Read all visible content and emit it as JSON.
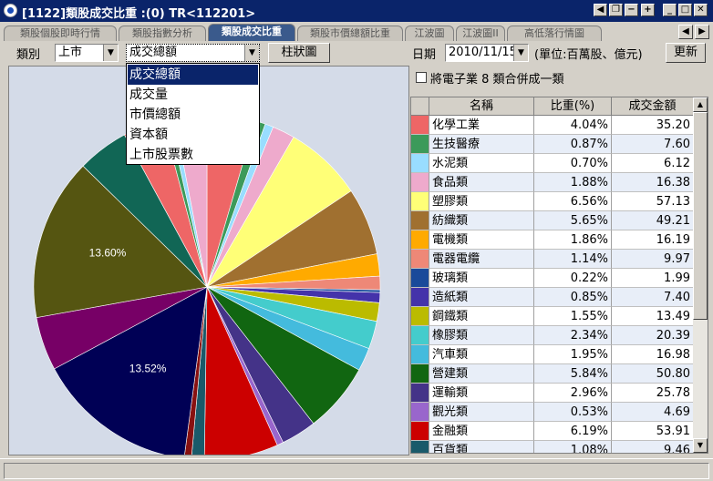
{
  "window": {
    "title": "[1122]類股成交比重 :(0) TR<112201>",
    "controls": [
      "◀",
      "❐",
      "−",
      "+",
      "_",
      "□",
      "✕"
    ]
  },
  "tabs": [
    {
      "label": "類股個股即時行情",
      "active": false
    },
    {
      "label": "類股指數分析",
      "active": false
    },
    {
      "label": "類股成交比重",
      "active": true
    },
    {
      "label": "類股市價總額比重",
      "active": false
    },
    {
      "label": "江波圖",
      "active": false
    },
    {
      "label": "江波圖II",
      "active": false
    },
    {
      "label": "高低落行情圖",
      "active": false
    }
  ],
  "toolbar": {
    "category_label": "類別",
    "market_value": "上市",
    "metric_value": "成交總額",
    "chart_button": "柱狀圖",
    "date_label": "日期",
    "date_value": "2010/11/15",
    "unit_label": "(單位:百萬股、億元)",
    "refresh_button": "更新"
  },
  "dropdown": {
    "options": [
      "成交總額",
      "成交量",
      "市價總額",
      "資本額",
      "上市股票數"
    ],
    "selected": "成交總額"
  },
  "merge_checkbox": {
    "label": "將電子業 8 類合併成一類",
    "checked": false
  },
  "table": {
    "headers": [
      "名稱",
      "比重(%)",
      "成交金額"
    ],
    "rows": [
      {
        "name": "化學工業",
        "pct": "4.04%",
        "amount": "35.20",
        "color": "#ee6666"
      },
      {
        "name": "生技醫療",
        "pct": "0.87%",
        "amount": "7.60",
        "color": "#3c9a5a"
      },
      {
        "name": "水泥類",
        "pct": "0.70%",
        "amount": "6.12",
        "color": "#99ddff"
      },
      {
        "name": "食品類",
        "pct": "1.88%",
        "amount": "16.38",
        "color": "#eeaacc"
      },
      {
        "name": "塑膠類",
        "pct": "6.56%",
        "amount": "57.13",
        "color": "#ffff77"
      },
      {
        "name": "紡織類",
        "pct": "5.65%",
        "amount": "49.21",
        "color": "#a07030"
      },
      {
        "name": "電機類",
        "pct": "1.86%",
        "amount": "16.19",
        "color": "#ffaa00"
      },
      {
        "name": "電器電纜",
        "pct": "1.14%",
        "amount": "9.97",
        "color": "#ee8877"
      },
      {
        "name": "玻璃類",
        "pct": "0.22%",
        "amount": "1.99",
        "color": "#1a4a9a"
      },
      {
        "name": "造紙類",
        "pct": "0.85%",
        "amount": "7.40",
        "color": "#4433aa"
      },
      {
        "name": "鋼鐵類",
        "pct": "1.55%",
        "amount": "13.49",
        "color": "#bbbb00"
      },
      {
        "name": "橡膠類",
        "pct": "2.34%",
        "amount": "20.39",
        "color": "#44cccc"
      },
      {
        "name": "汽車類",
        "pct": "1.95%",
        "amount": "16.98",
        "color": "#44bbdd"
      },
      {
        "name": "營建類",
        "pct": "5.84%",
        "amount": "50.80",
        "color": "#116611"
      },
      {
        "name": "運輸類",
        "pct": "2.96%",
        "amount": "25.78",
        "color": "#443388"
      },
      {
        "name": "觀光類",
        "pct": "0.53%",
        "amount": "4.69",
        "color": "#9966cc"
      },
      {
        "name": "金融類",
        "pct": "6.19%",
        "amount": "53.91",
        "color": "#cc0000"
      },
      {
        "name": "百貨類",
        "pct": "1.08%",
        "amount": "9.46",
        "color": "#1a5a6a"
      }
    ]
  },
  "chart_data": {
    "type": "pie",
    "series": [
      {
        "name": "化學工業",
        "value": 4.04,
        "color": "#ee6666"
      },
      {
        "name": "生技醫療",
        "value": 0.87,
        "color": "#3c9a5a"
      },
      {
        "name": "水泥類",
        "value": 0.7,
        "color": "#99ddff"
      },
      {
        "name": "食品類",
        "value": 1.88,
        "color": "#eeaacc"
      },
      {
        "name": "塑膠類",
        "value": 6.56,
        "color": "#ffff77"
      },
      {
        "name": "紡織類",
        "value": 5.65,
        "color": "#a07030"
      },
      {
        "name": "電機類",
        "value": 1.86,
        "color": "#ffaa00"
      },
      {
        "name": "電器電纜",
        "value": 1.14,
        "color": "#ee8877"
      },
      {
        "name": "玻璃類",
        "value": 0.22,
        "color": "#1a4a9a"
      },
      {
        "name": "造紙類",
        "value": 0.85,
        "color": "#4433aa"
      },
      {
        "name": "鋼鐵類",
        "value": 1.55,
        "color": "#bbbb00"
      },
      {
        "name": "橡膠類",
        "value": 2.34,
        "color": "#44cccc"
      },
      {
        "name": "汽車類",
        "value": 1.95,
        "color": "#44bbdd"
      },
      {
        "name": "營建類",
        "value": 5.84,
        "color": "#116611"
      },
      {
        "name": "運輸類",
        "value": 2.96,
        "color": "#443388"
      },
      {
        "name": "觀光類",
        "value": 0.53,
        "color": "#9966cc"
      },
      {
        "name": "金融類",
        "value": 6.19,
        "color": "#cc0000"
      },
      {
        "name": "百貨類",
        "value": 1.08,
        "color": "#1a5a6a"
      },
      {
        "name": "",
        "value": 0.6,
        "color": "#881111"
      },
      {
        "name": "",
        "value": 13.52,
        "color": "#000055"
      },
      {
        "name": "",
        "value": 4.5,
        "color": "#770066"
      },
      {
        "name": "",
        "value": 13.6,
        "color": "#555511"
      },
      {
        "name": "",
        "value": 4.3,
        "color": "#116655"
      },
      {
        "name": "",
        "value": 3.4,
        "color": "#ee6666"
      },
      {
        "name": "",
        "value": 0.5,
        "color": "#3c9a5a"
      },
      {
        "name": "",
        "value": 0.5,
        "color": "#99ddff"
      },
      {
        "name": "",
        "value": 2.7,
        "color": "#eeaacc"
      }
    ],
    "data_labels": [
      "13.60%",
      "13.52%"
    ]
  }
}
